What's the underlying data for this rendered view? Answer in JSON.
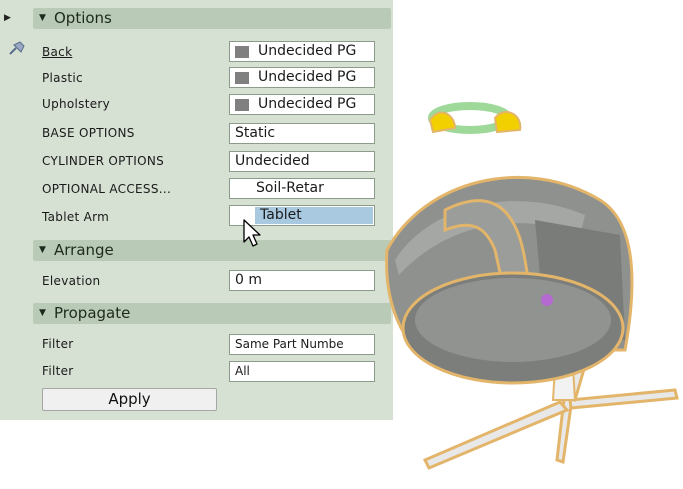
{
  "options": {
    "header": "Options",
    "rows": [
      {
        "label": "Back",
        "value": "Undecided PG",
        "swatch": true
      },
      {
        "label": "Plastic",
        "value": "Undecided PG",
        "swatch": true
      },
      {
        "label": "Upholstery",
        "value": "Undecided PG",
        "swatch": true
      },
      {
        "label": "BASE OPTIONS",
        "value": "Static"
      },
      {
        "label": "CYLINDER OPTIONS",
        "value": "Undecided"
      },
      {
        "label": "OPTIONAL ACCESS...",
        "value": "Soil-Retar"
      },
      {
        "label": "Tablet Arm",
        "value": "Tablet"
      }
    ]
  },
  "arrange": {
    "header": "Arrange",
    "elevation_label": "Elevation",
    "elevation_value": "0 m"
  },
  "propagate": {
    "header": "Propagate",
    "filter1_label": "Filter",
    "filter1_value": "Same Part Numbe",
    "filter2_label": "Filter",
    "filter2_value": "All",
    "apply_label": "Apply"
  },
  "colors": {
    "panel_bg": "#d6e0d3",
    "header_bg": "#b9cbb6",
    "swatch": "#808080",
    "selection": "#a9c9e1",
    "chair_outline": "#e3b56a",
    "chair_body": "#8e918e",
    "handle_yellow": "#f2d000",
    "handle_green": "#9fd99a"
  },
  "icons": [
    "collapse-arrow-icon",
    "pin-icon",
    "mouse-pointer-icon"
  ]
}
